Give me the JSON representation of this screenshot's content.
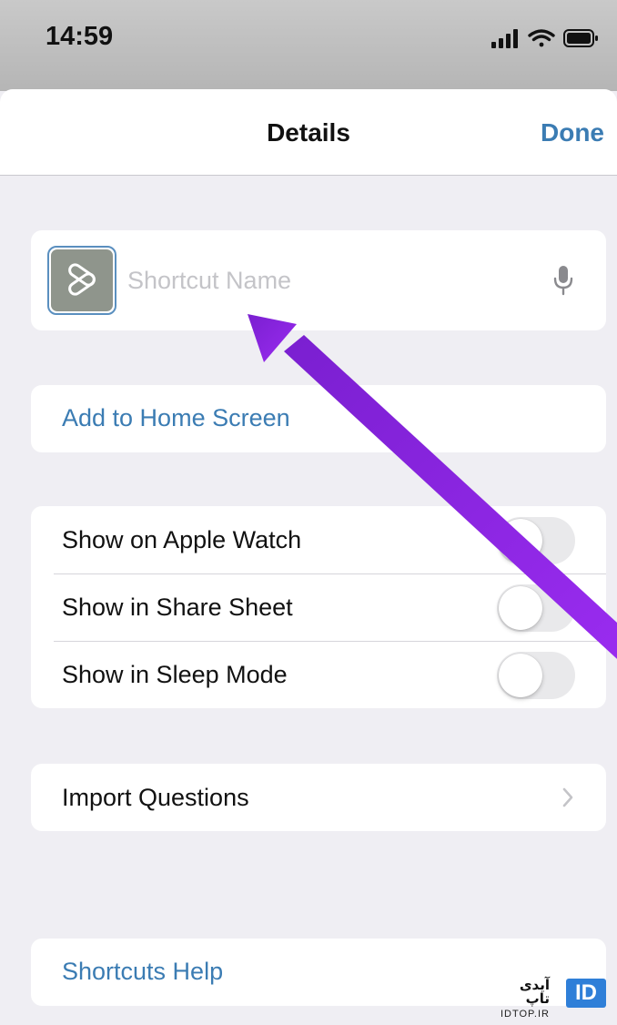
{
  "status_bar": {
    "time": "14:59",
    "icons": [
      "cellular-signal-icon",
      "wifi-icon",
      "battery-icon"
    ]
  },
  "nav": {
    "title": "Details",
    "done_label": "Done"
  },
  "shortcut": {
    "icon": "shortcuts-layers-icon",
    "name_placeholder": "Shortcut Name",
    "name_value": "",
    "dictation_icon": "microphone-icon"
  },
  "add_to_home_label": "Add to Home Screen",
  "toggles": [
    {
      "label": "Show on Apple Watch",
      "on": false
    },
    {
      "label": "Show in Share Sheet",
      "on": false
    },
    {
      "label": "Show in Sleep Mode",
      "on": false
    }
  ],
  "import_questions": {
    "label": "Import Questions",
    "chevron_icon": "chevron-right-icon"
  },
  "help_label": "Shortcuts Help",
  "watermark": {
    "text_fa": "آیدی تاپ",
    "url": "IDTOP.IR",
    "logo": "ID"
  },
  "colors": {
    "accent": "#3b7cb3",
    "background": "#efeef3",
    "card": "#ffffff",
    "annotation_arrow": "#8f1fe0"
  }
}
